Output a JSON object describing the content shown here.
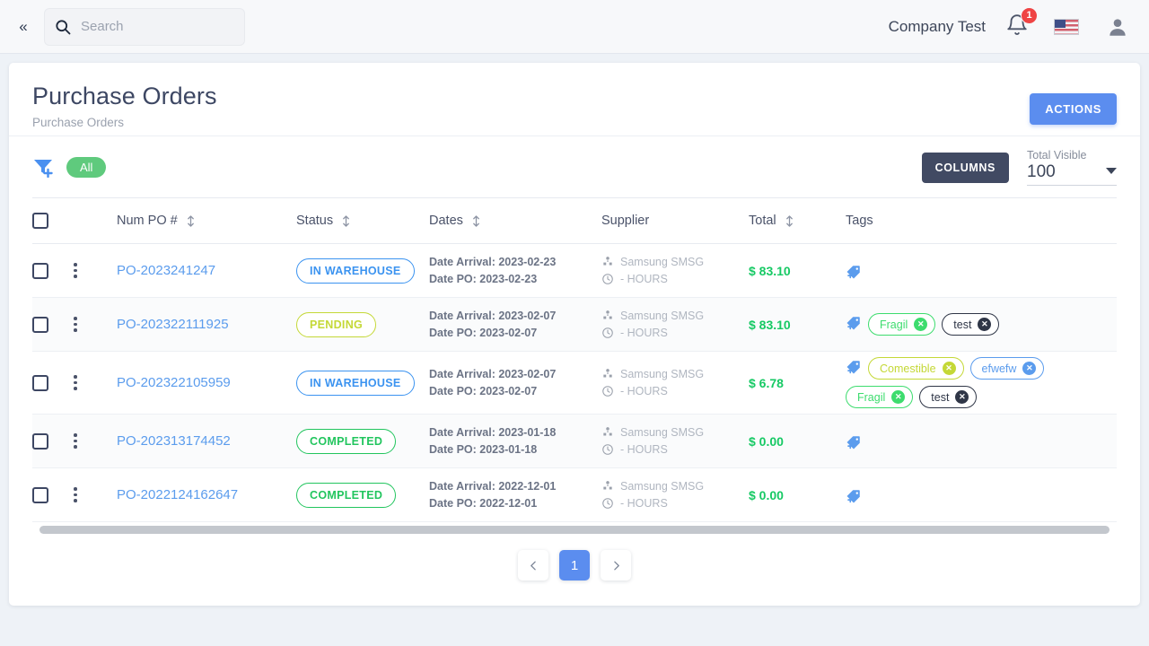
{
  "topbar": {
    "collapse_icon": "chevron-double-left-icon",
    "search_icon": "search-icon",
    "search_placeholder": "Search",
    "search_value": "",
    "company": "Company Test",
    "bell_icon": "bell-icon",
    "bell_badge": "1",
    "flag_icon": "us-flag-icon",
    "avatar_icon": "user-avatar-icon"
  },
  "page": {
    "title": "Purchase Orders",
    "breadcrumb": "Purchase Orders",
    "actions_label": "ACTIONS"
  },
  "toolbar": {
    "filter_icon": "filter-add-icon",
    "filter_pill": "All",
    "columns_label": "COLUMNS",
    "total_visible_label": "Total Visible",
    "total_visible_value": "100",
    "caret_icon": "chevron-down-icon"
  },
  "table": {
    "columns": [
      {
        "key": "check",
        "label": "",
        "sortable": false
      },
      {
        "key": "menu",
        "label": "",
        "sortable": false
      },
      {
        "key": "po",
        "label": "Num PO #",
        "sortable": true
      },
      {
        "key": "status",
        "label": "Status",
        "sortable": true
      },
      {
        "key": "dates",
        "label": "Dates",
        "sortable": true
      },
      {
        "key": "supplier",
        "label": "Supplier",
        "sortable": false
      },
      {
        "key": "total",
        "label": "Total",
        "sortable": true
      },
      {
        "key": "tags",
        "label": "Tags",
        "sortable": false
      }
    ],
    "labels": {
      "date_arrival_prefix": "Date Arrival: ",
      "date_po_prefix": "Date PO: "
    },
    "rows": [
      {
        "po": "PO-2023241247",
        "status": "IN WAREHOUSE",
        "status_class": "inwarehouse",
        "date_arrival": "2023-02-23",
        "date_po": "2023-02-23",
        "supplier": "Samsung SMSG",
        "hours": "- HOURS",
        "total": "$ 83.10",
        "tags": []
      },
      {
        "po": "PO-202322111925",
        "status": "PENDING",
        "status_class": "pending",
        "date_arrival": "2023-02-07",
        "date_po": "2023-02-07",
        "supplier": "Samsung SMSG",
        "hours": "- HOURS",
        "total": "$ 83.10",
        "tags": [
          {
            "label": "Fragil",
            "color": "green"
          },
          {
            "label": "test",
            "color": "dark"
          }
        ]
      },
      {
        "po": "PO-202322105959",
        "status": "IN WAREHOUSE",
        "status_class": "inwarehouse",
        "date_arrival": "2023-02-07",
        "date_po": "2023-02-07",
        "supplier": "Samsung SMSG",
        "hours": "- HOURS",
        "total": "$ 6.78",
        "tags": [
          {
            "label": "Comestible",
            "color": "lime"
          },
          {
            "label": "efwefw",
            "color": "blue"
          },
          {
            "label": "Fragil",
            "color": "green"
          },
          {
            "label": "test",
            "color": "dark"
          }
        ]
      },
      {
        "po": "PO-202313174452",
        "status": "COMPLETED",
        "status_class": "completed",
        "date_arrival": "2023-01-18",
        "date_po": "2023-01-18",
        "supplier": "Samsung SMSG",
        "hours": "- HOURS",
        "total": "$ 0.00",
        "tags": []
      },
      {
        "po": "PO-2022124162647",
        "status": "COMPLETED",
        "status_class": "completed",
        "date_arrival": "2022-12-01",
        "date_po": "2022-12-01",
        "supplier": "Samsung SMSG",
        "hours": "- HOURS",
        "total": "$ 0.00",
        "tags": []
      }
    ]
  },
  "pagination": {
    "prev_icon": "chevron-left-icon",
    "next_icon": "chevron-right-icon",
    "pages": [
      "1"
    ],
    "current": "1"
  },
  "colors": {
    "accent_blue": "#5b8def",
    "link_blue": "#5b9ced",
    "green": "#22c55e",
    "lime": "#c4d836",
    "dark_navy": "#414a63",
    "money_green": "#16c964",
    "badge_red": "#ef4444"
  }
}
